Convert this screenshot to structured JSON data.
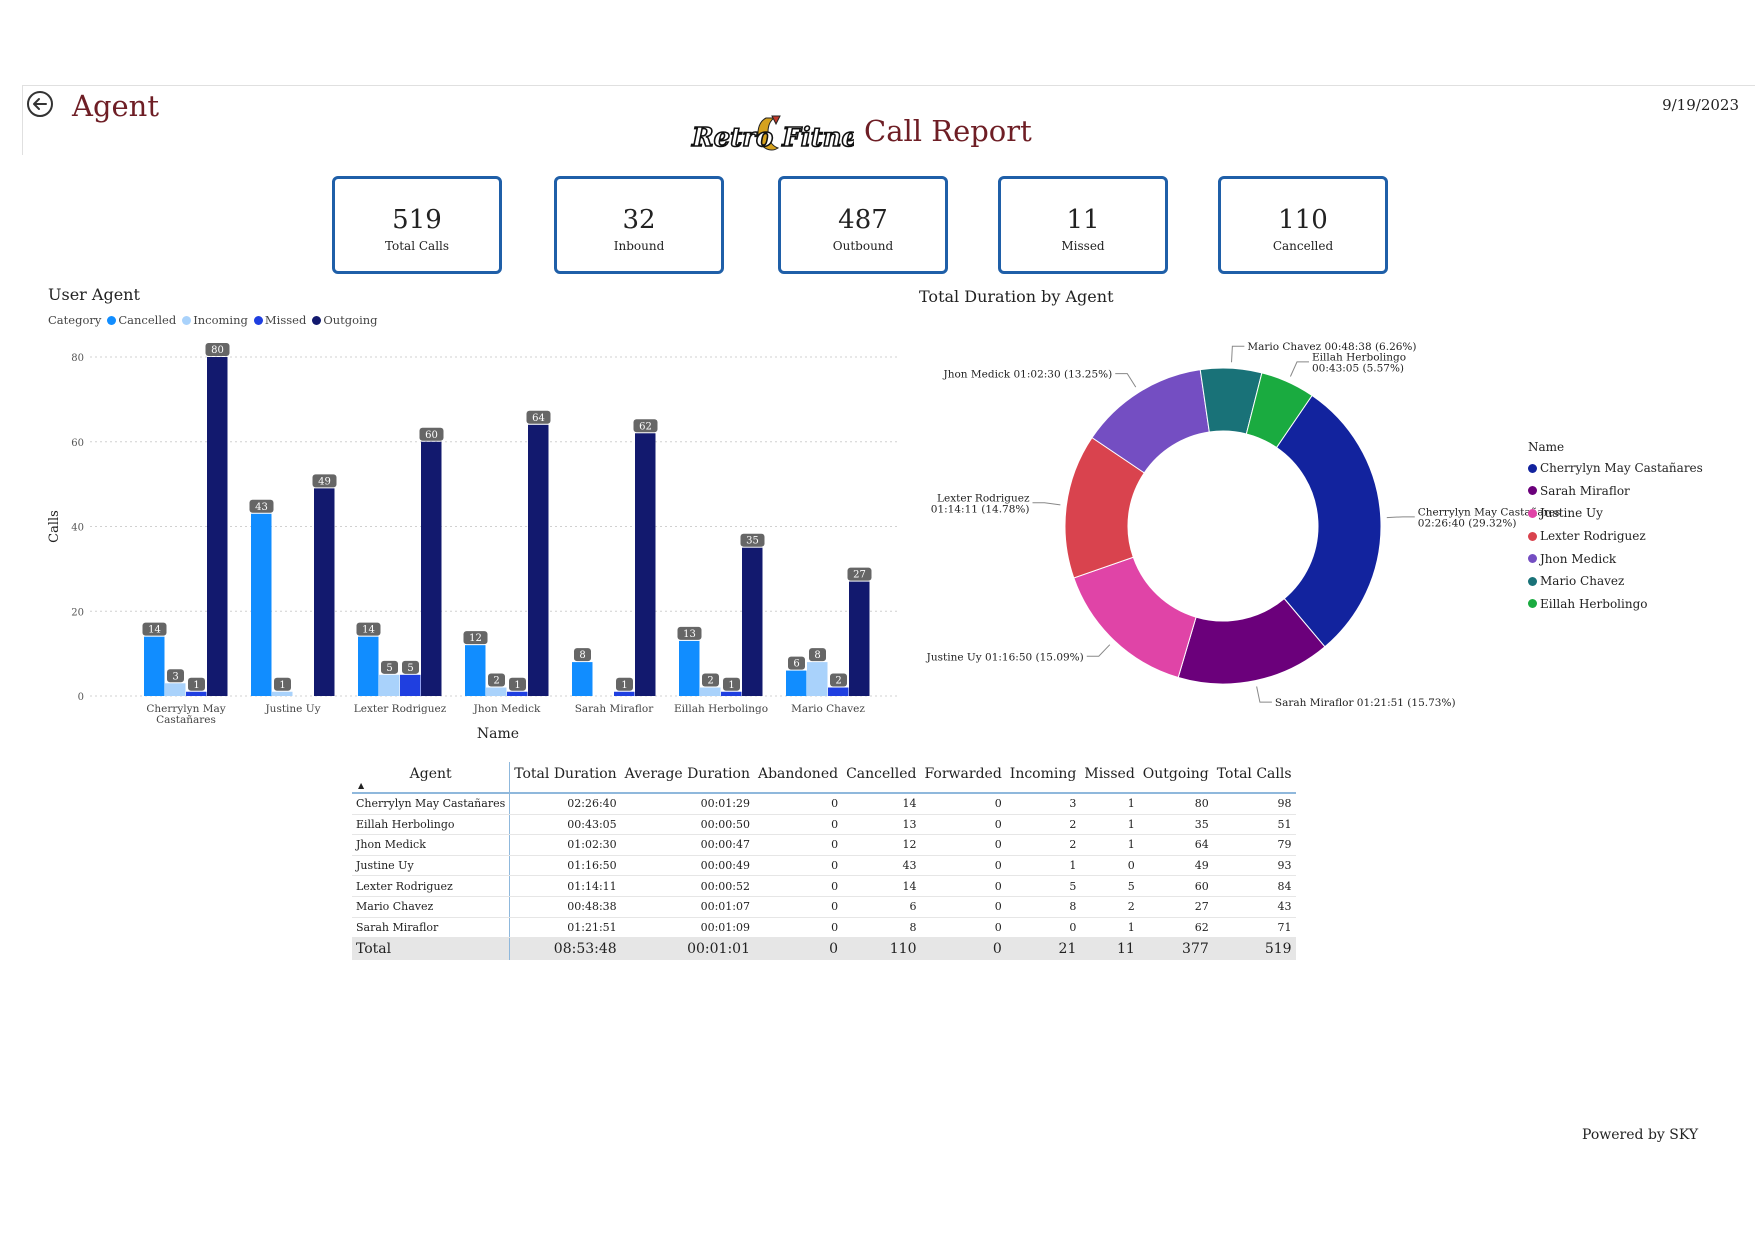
{
  "header": {
    "page_title": "Agent",
    "report_title": "Call Report",
    "logo_text": "Retro Fitness",
    "date": "9/19/2023"
  },
  "kpis": [
    {
      "value": "519",
      "label": "Total Calls"
    },
    {
      "value": "32",
      "label": "Inbound"
    },
    {
      "value": "487",
      "label": "Outbound"
    },
    {
      "value": "11",
      "label": "Missed"
    },
    {
      "value": "110",
      "label": "Cancelled"
    }
  ],
  "bar_section": {
    "title": "User Agent",
    "legend_title": "Category"
  },
  "pie_section": {
    "title": "Total Duration by Agent",
    "legend_title": "Name"
  },
  "chart_data": [
    {
      "type": "bar",
      "title": "User Agent",
      "xlabel": "Name",
      "ylabel": "Calls",
      "ylim": [
        0,
        80
      ],
      "yticks": [
        0,
        20,
        40,
        60,
        80
      ],
      "grid": true,
      "legend_position": "top-left",
      "categories": [
        "Cherrylyn May Castañares",
        "Justine Uy",
        "Lexter Rodriguez",
        "Jhon Medick",
        "Sarah Miraflor",
        "Eillah Herbolingo",
        "Mario Chavez"
      ],
      "series": [
        {
          "name": "Cancelled",
          "color": "#118dff",
          "values": [
            14,
            43,
            14,
            12,
            8,
            13,
            6
          ]
        },
        {
          "name": "Incoming",
          "color": "#a9d2fb",
          "values": [
            3,
            1,
            5,
            2,
            0,
            2,
            8
          ]
        },
        {
          "name": "Missed",
          "color": "#1f3fe0",
          "values": [
            1,
            0,
            5,
            1,
            1,
            1,
            2
          ]
        },
        {
          "name": "Outgoing",
          "color": "#12196e",
          "values": [
            80,
            49,
            60,
            64,
            62,
            35,
            27
          ]
        }
      ]
    },
    {
      "type": "pie",
      "title": "Total Duration by Agent",
      "donut": true,
      "slices": [
        {
          "name": "Cherrylyn May Castañares",
          "duration": "02:26:40",
          "percent": 29.32,
          "color": "#12239e",
          "label": "Cherrylyn May Castañares\n02:26:40 (29.32%)"
        },
        {
          "name": "Sarah Miraflor",
          "duration": "01:21:51",
          "percent": 15.73,
          "color": "#6b007b",
          "label": "Sarah Miraflor 01:21:51 (15.73%)"
        },
        {
          "name": "Justine Uy",
          "duration": "01:16:50",
          "percent": 15.09,
          "color": "#e044a7",
          "label": "Justine Uy 01:16:50 (15.09%)"
        },
        {
          "name": "Lexter Rodriguez",
          "duration": "01:14:11",
          "percent": 14.78,
          "color": "#d9434e",
          "label": "Lexter Rodriguez\n01:14:11 (14.78%)"
        },
        {
          "name": "Jhon Medick",
          "duration": "01:02:30",
          "percent": 13.25,
          "color": "#744ec2",
          "label": "Jhon Medick 01:02:30 (13.25%)"
        },
        {
          "name": "Mario Chavez",
          "duration": "00:48:38",
          "percent": 6.26,
          "color": "#197278",
          "label": "Mario Chavez 00:48:38 (6.26%)"
        },
        {
          "name": "Eillah Herbolingo",
          "duration": "00:43:05",
          "percent": 5.57,
          "color": "#1aab40",
          "label": "Eillah Herbolingo\n00:43:05 (5.57%)"
        }
      ]
    },
    {
      "type": "table",
      "columns": [
        "Agent",
        "Total Duration",
        "Average Duration",
        "Abandoned",
        "Cancelled",
        "Forwarded",
        "Incoming",
        "Missed",
        "Outgoing",
        "Total Calls"
      ],
      "rows": [
        [
          "Cherrylyn May Castañares",
          "02:26:40",
          "00:01:29",
          "0",
          "14",
          "0",
          "3",
          "1",
          "80",
          "98"
        ],
        [
          "Eillah Herbolingo",
          "00:43:05",
          "00:00:50",
          "0",
          "13",
          "0",
          "2",
          "1",
          "35",
          "51"
        ],
        [
          "Jhon Medick",
          "01:02:30",
          "00:00:47",
          "0",
          "12",
          "0",
          "2",
          "1",
          "64",
          "79"
        ],
        [
          "Justine Uy",
          "01:16:50",
          "00:00:49",
          "0",
          "43",
          "0",
          "1",
          "0",
          "49",
          "93"
        ],
        [
          "Lexter Rodriguez",
          "01:14:11",
          "00:00:52",
          "0",
          "14",
          "0",
          "5",
          "5",
          "60",
          "84"
        ],
        [
          "Mario Chavez",
          "00:48:38",
          "00:01:07",
          "0",
          "6",
          "0",
          "8",
          "2",
          "27",
          "43"
        ],
        [
          "Sarah Miraflor",
          "01:21:51",
          "00:01:09",
          "0",
          "8",
          "0",
          "0",
          "1",
          "62",
          "71"
        ]
      ],
      "total": [
        "Total",
        "08:53:48",
        "00:01:01",
        "0",
        "110",
        "0",
        "21",
        "11",
        "377",
        "519"
      ]
    }
  ],
  "footer": {
    "powered_by": "Powered by SKY"
  }
}
